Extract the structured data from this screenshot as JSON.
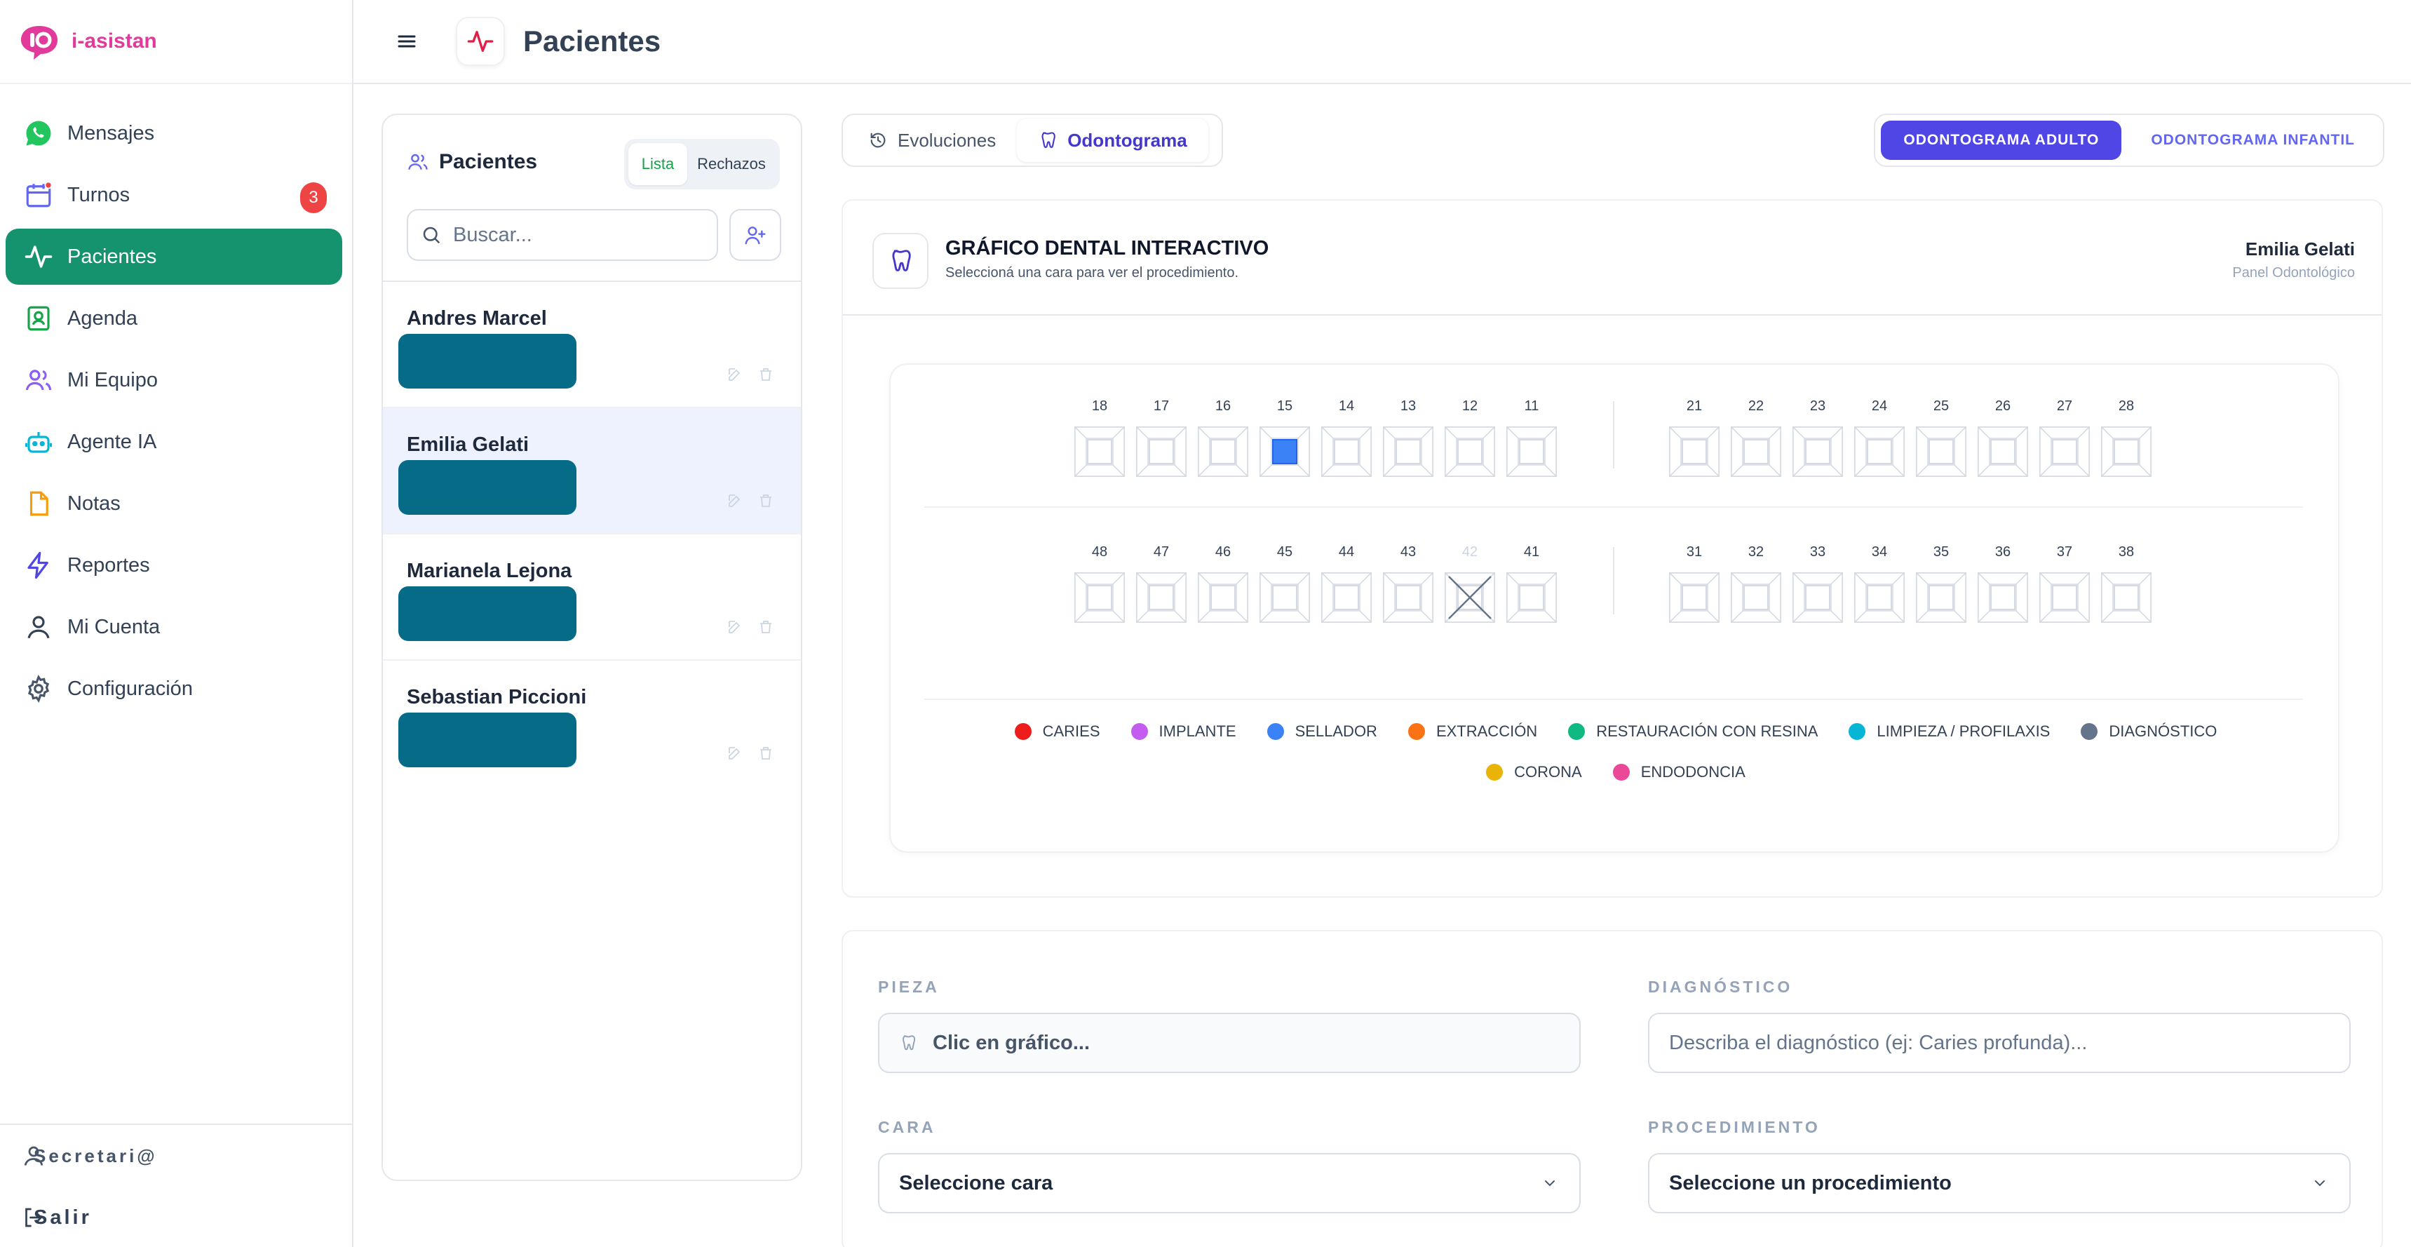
{
  "brand": {
    "name": "i-asistan"
  },
  "header": {
    "title": "Pacientes"
  },
  "sidebar": {
    "items": [
      {
        "label": "Mensajes",
        "icon": "whatsapp-icon"
      },
      {
        "label": "Turnos",
        "icon": "calendar-icon",
        "badge": "3"
      },
      {
        "label": "Pacientes",
        "icon": "pulse-icon",
        "active": true
      },
      {
        "label": "Agenda",
        "icon": "contact-book-icon"
      },
      {
        "label": "Mi Equipo",
        "icon": "users-icon"
      },
      {
        "label": "Agente IA",
        "icon": "bot-icon"
      },
      {
        "label": "Notas",
        "icon": "note-icon"
      },
      {
        "label": "Reportes",
        "icon": "bolt-icon"
      },
      {
        "label": "Mi Cuenta",
        "icon": "user-icon"
      },
      {
        "label": "Configuración",
        "icon": "gear-icon"
      }
    ],
    "footer": {
      "user": "Secretari@",
      "logout": "Salir"
    }
  },
  "patients": {
    "title": "Pacientes",
    "seg": [
      "Lista",
      "Rechazos"
    ],
    "search_placeholder": "Buscar...",
    "list": [
      {
        "name": "Andres Marcel"
      },
      {
        "name": "Emilia Gelati",
        "selected": true
      },
      {
        "name": "Marianela Lejona"
      },
      {
        "name": "Sebastian Piccioni"
      }
    ]
  },
  "tabs": [
    "Evoluciones",
    "Odontograma"
  ],
  "mode": [
    "ODONTOGRAMA ADULTO",
    "ODONTOGRAMA INFANTIL"
  ],
  "chart": {
    "title": "GRÁFICO DENTAL INTERACTIVO",
    "subtitle": "Seleccioná una cara para ver el procedimiento.",
    "user": "Emilia Gelati",
    "panel": "Panel Odontológico",
    "upper_left": [
      "18",
      "17",
      "16",
      "15",
      "14",
      "13",
      "12",
      "11"
    ],
    "upper_right": [
      "21",
      "22",
      "23",
      "24",
      "25",
      "26",
      "27",
      "28"
    ],
    "lower_left": [
      "48",
      "47",
      "46",
      "45",
      "44",
      "43",
      "42",
      "41"
    ],
    "lower_right": [
      "31",
      "32",
      "33",
      "34",
      "35",
      "36",
      "37",
      "38"
    ],
    "sealed_tooth": "15",
    "missing_tooth": "42",
    "legend": [
      {
        "label": "CARIES",
        "color": "#ef1c1c"
      },
      {
        "label": "IMPLANTE",
        "color": "#c45cf0"
      },
      {
        "label": "SELLADOR",
        "color": "#3b82f6"
      },
      {
        "label": "EXTRACCIÓN",
        "color": "#f97316"
      },
      {
        "label": "RESTAURACIÓN CON RESINA",
        "color": "#10b981"
      },
      {
        "label": "LIMPIEZA / PROFILAXIS",
        "color": "#06b6d4"
      },
      {
        "label": "DIAGNÓSTICO",
        "color": "#64748b"
      },
      {
        "label": "CORONA",
        "color": "#eab308"
      },
      {
        "label": "ENDODONCIA",
        "color": "#ec4899"
      }
    ]
  },
  "form": {
    "pieza_label": "PIEZA",
    "pieza_value": "Clic en gráfico...",
    "diag_label": "DIAGNÓSTICO",
    "diag_placeholder": "Describa el diagnóstico (ej: Caries profunda)...",
    "cara_label": "CARA",
    "cara_value": "Seleccione cara",
    "proc_label": "PROCEDIMIENTO",
    "proc_value": "Seleccione un procedimiento"
  }
}
